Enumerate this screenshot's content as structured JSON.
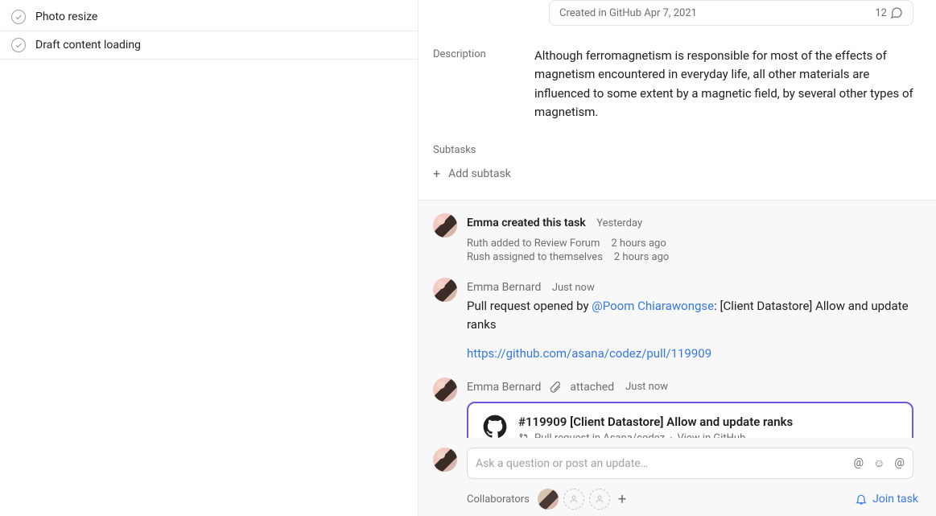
{
  "left": {
    "tasks": [
      {
        "title": "Photo resize"
      },
      {
        "title": "Draft content loading"
      }
    ]
  },
  "detail": {
    "github_pill": {
      "text": "Created in GitHub Apr 7, 2021",
      "count": "12"
    },
    "description_label": "Description",
    "description_text": "Although ferromagnetism is responsible for most of the effects of magnetism encountered in everyday life, all other materials are influenced to some extent by a magnetic field, by several other types of magnetism.",
    "subtasks_label": "Subtasks",
    "add_subtask": "Add subtask"
  },
  "activity": {
    "created": {
      "actor": "Emma",
      "verb": "created this task",
      "time": "Yesterday"
    },
    "subs": [
      {
        "text": "Ruth added to Review Forum",
        "time": "2 hours ago"
      },
      {
        "text": "Rush assigned to themselves",
        "time": "2 hours ago"
      }
    ],
    "comment": {
      "author": "Emma Bernard",
      "time": "Just now",
      "body_prefix": "Pull request opened by ",
      "mention": "@Poom Chiarawongse",
      "body_suffix": ": [Client Datastore] Allow and update ranks",
      "link": "https://github.com/asana/codez/pull/119909"
    },
    "attachment_event": {
      "author": "Emma Bernard",
      "verb": "attached",
      "time": "Just now"
    },
    "attachment": {
      "title": "#119909 [Client Datastore] Allow and update ranks",
      "meta_repo": "Pull request in Asana/codez",
      "meta_view": "View in GitHub"
    }
  },
  "composer": {
    "placeholder": "Ask a question or post an update…"
  },
  "footer": {
    "collaborators_label": "Collaborators",
    "join_label": "Join task"
  }
}
